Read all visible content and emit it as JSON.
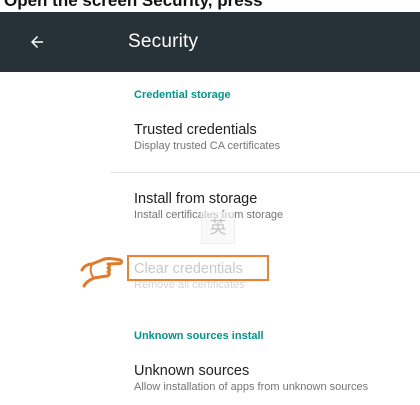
{
  "caption": {
    "text": "Open the screen Security, press"
  },
  "toolbar": {
    "title": "Security",
    "back_icon": "arrow-back-icon"
  },
  "sections": {
    "credential_storage": {
      "header": "Credential storage"
    },
    "unknown_sources": {
      "header": "Unknown sources install"
    }
  },
  "items": {
    "trusted_credentials": {
      "title": "Trusted credentials",
      "subtitle": "Display trusted CA certificates"
    },
    "install_from_storage": {
      "title": "Install from storage",
      "subtitle": "Install certificates from storage"
    },
    "clear_credentials": {
      "title": "Clear credentials",
      "subtitle": "Remove all certificates"
    },
    "unknown_sources": {
      "title": "Unknown sources",
      "subtitle": "Allow installation of apps from unknown sources"
    }
  },
  "watermark": {
    "text": "英"
  },
  "colors": {
    "toolbar_bg": "#263238",
    "accent": "#009688",
    "highlight": "#f08030"
  }
}
